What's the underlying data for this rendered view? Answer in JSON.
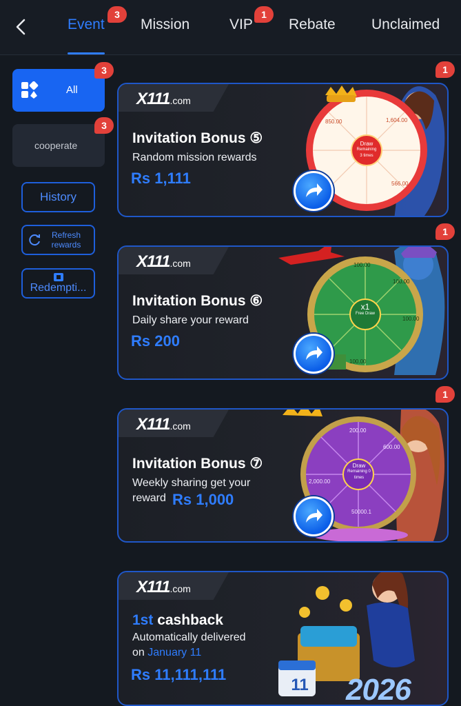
{
  "nav": {
    "tabs": [
      {
        "label": "Event",
        "badge": "3"
      },
      {
        "label": "Mission"
      },
      {
        "label": "VIP",
        "badge": "1"
      },
      {
        "label": "Rebate"
      },
      {
        "label": "Unclaimed"
      }
    ]
  },
  "sidebar": {
    "all": {
      "label": "All",
      "badge": "3"
    },
    "cooperate": {
      "label": "cooperate",
      "badge": "3"
    },
    "history": "History",
    "refresh": "Refresh rewards",
    "redemption": "Redempti..."
  },
  "cards": [
    {
      "logo": "X111",
      "logo_suffix": ".com",
      "title": "Invitation Bonus ⑤",
      "subtitle": "Random mission rewards",
      "amount": "Rs 1,111",
      "badge": "1",
      "wheel_center": "Draw",
      "wheel_center_sub": "Remaining 3 times",
      "wheel_values": [
        "850.00",
        "1,604.00",
        "566.00",
        "50"
      ]
    },
    {
      "logo": "X111",
      "logo_suffix": ".com",
      "title": "Invitation Bonus ⑥",
      "subtitle": "Daily share your reward",
      "amount": "Rs 200",
      "badge": "1",
      "wheel_center": "x1",
      "wheel_center_sub": "Free Draw",
      "wheel_values": [
        "100.00",
        "100.00",
        "100.00",
        "100.00"
      ]
    },
    {
      "logo": "X111",
      "logo_suffix": ".com",
      "title": "Invitation Bonus ⑦",
      "subtitle_line1": "Weekly sharing get your",
      "subtitle_line2": "reward",
      "amount": "Rs 1,000",
      "badge": "1",
      "wheel_center": "Draw",
      "wheel_center_sub": "Remaining 0 times",
      "wheel_values": [
        "200.00",
        "600.00",
        "50000.1",
        "2,000.00"
      ]
    },
    {
      "logo": "X111",
      "logo_suffix": ".com",
      "title_accent": "1st",
      "title": "cashback",
      "subtitle_line1": "Automatically delivered",
      "subtitle_prefix": "on",
      "subtitle_date": "January 11",
      "amount": "Rs 11,111,111",
      "calendar_day": "11",
      "year": "2026"
    }
  ],
  "colors": {
    "accent": "#2f7dff",
    "badge": "#e2413a",
    "background": "#141920"
  },
  "icons": [
    "back-chevron-icon",
    "grid-icon",
    "refresh-icon",
    "ticket-icon",
    "arrow-go-icon"
  ]
}
